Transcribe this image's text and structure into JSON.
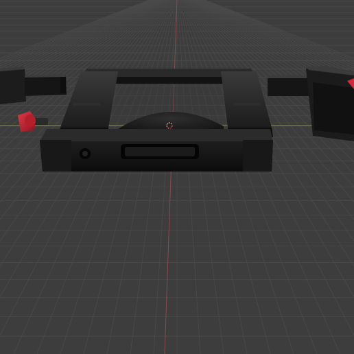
{
  "viewport": {
    "background": "#3d3d3d",
    "grid_color": "#4a4a4a",
    "x_axis_color": "#8a4a52",
    "y_axis_color": "#7f8c4a"
  },
  "scene": {
    "objects": [
      {
        "name": "cage-frame",
        "color": "#151515"
      },
      {
        "name": "thumb-screw",
        "color": "#c21e2d"
      },
      {
        "name": "left-side-handle",
        "color": "#1a1a1a"
      },
      {
        "name": "right-side-handle",
        "color": "#1a1a1a"
      }
    ],
    "origin_marker_icon": "crosshair-icon"
  }
}
